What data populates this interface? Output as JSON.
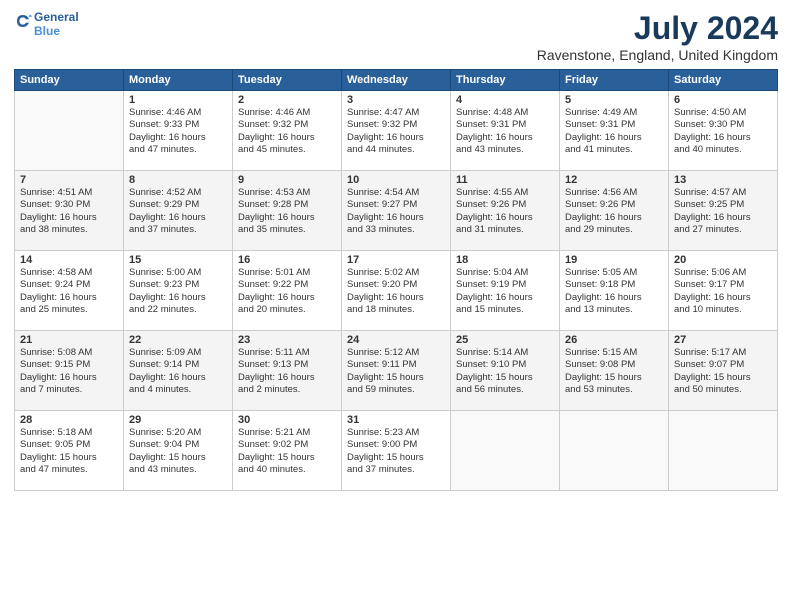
{
  "logo": {
    "line1": "General",
    "line2": "Blue"
  },
  "title": "July 2024",
  "location": "Ravenstone, England, United Kingdom",
  "weekdays": [
    "Sunday",
    "Monday",
    "Tuesday",
    "Wednesday",
    "Thursday",
    "Friday",
    "Saturday"
  ],
  "weeks": [
    [
      {
        "day": "",
        "info": ""
      },
      {
        "day": "1",
        "info": "Sunrise: 4:46 AM\nSunset: 9:33 PM\nDaylight: 16 hours\nand 47 minutes."
      },
      {
        "day": "2",
        "info": "Sunrise: 4:46 AM\nSunset: 9:32 PM\nDaylight: 16 hours\nand 45 minutes."
      },
      {
        "day": "3",
        "info": "Sunrise: 4:47 AM\nSunset: 9:32 PM\nDaylight: 16 hours\nand 44 minutes."
      },
      {
        "day": "4",
        "info": "Sunrise: 4:48 AM\nSunset: 9:31 PM\nDaylight: 16 hours\nand 43 minutes."
      },
      {
        "day": "5",
        "info": "Sunrise: 4:49 AM\nSunset: 9:31 PM\nDaylight: 16 hours\nand 41 minutes."
      },
      {
        "day": "6",
        "info": "Sunrise: 4:50 AM\nSunset: 9:30 PM\nDaylight: 16 hours\nand 40 minutes."
      }
    ],
    [
      {
        "day": "7",
        "info": "Sunrise: 4:51 AM\nSunset: 9:30 PM\nDaylight: 16 hours\nand 38 minutes."
      },
      {
        "day": "8",
        "info": "Sunrise: 4:52 AM\nSunset: 9:29 PM\nDaylight: 16 hours\nand 37 minutes."
      },
      {
        "day": "9",
        "info": "Sunrise: 4:53 AM\nSunset: 9:28 PM\nDaylight: 16 hours\nand 35 minutes."
      },
      {
        "day": "10",
        "info": "Sunrise: 4:54 AM\nSunset: 9:27 PM\nDaylight: 16 hours\nand 33 minutes."
      },
      {
        "day": "11",
        "info": "Sunrise: 4:55 AM\nSunset: 9:26 PM\nDaylight: 16 hours\nand 31 minutes."
      },
      {
        "day": "12",
        "info": "Sunrise: 4:56 AM\nSunset: 9:26 PM\nDaylight: 16 hours\nand 29 minutes."
      },
      {
        "day": "13",
        "info": "Sunrise: 4:57 AM\nSunset: 9:25 PM\nDaylight: 16 hours\nand 27 minutes."
      }
    ],
    [
      {
        "day": "14",
        "info": "Sunrise: 4:58 AM\nSunset: 9:24 PM\nDaylight: 16 hours\nand 25 minutes."
      },
      {
        "day": "15",
        "info": "Sunrise: 5:00 AM\nSunset: 9:23 PM\nDaylight: 16 hours\nand 22 minutes."
      },
      {
        "day": "16",
        "info": "Sunrise: 5:01 AM\nSunset: 9:22 PM\nDaylight: 16 hours\nand 20 minutes."
      },
      {
        "day": "17",
        "info": "Sunrise: 5:02 AM\nSunset: 9:20 PM\nDaylight: 16 hours\nand 18 minutes."
      },
      {
        "day": "18",
        "info": "Sunrise: 5:04 AM\nSunset: 9:19 PM\nDaylight: 16 hours\nand 15 minutes."
      },
      {
        "day": "19",
        "info": "Sunrise: 5:05 AM\nSunset: 9:18 PM\nDaylight: 16 hours\nand 13 minutes."
      },
      {
        "day": "20",
        "info": "Sunrise: 5:06 AM\nSunset: 9:17 PM\nDaylight: 16 hours\nand 10 minutes."
      }
    ],
    [
      {
        "day": "21",
        "info": "Sunrise: 5:08 AM\nSunset: 9:15 PM\nDaylight: 16 hours\nand 7 minutes."
      },
      {
        "day": "22",
        "info": "Sunrise: 5:09 AM\nSunset: 9:14 PM\nDaylight: 16 hours\nand 4 minutes."
      },
      {
        "day": "23",
        "info": "Sunrise: 5:11 AM\nSunset: 9:13 PM\nDaylight: 16 hours\nand 2 minutes."
      },
      {
        "day": "24",
        "info": "Sunrise: 5:12 AM\nSunset: 9:11 PM\nDaylight: 15 hours\nand 59 minutes."
      },
      {
        "day": "25",
        "info": "Sunrise: 5:14 AM\nSunset: 9:10 PM\nDaylight: 15 hours\nand 56 minutes."
      },
      {
        "day": "26",
        "info": "Sunrise: 5:15 AM\nSunset: 9:08 PM\nDaylight: 15 hours\nand 53 minutes."
      },
      {
        "day": "27",
        "info": "Sunrise: 5:17 AM\nSunset: 9:07 PM\nDaylight: 15 hours\nand 50 minutes."
      }
    ],
    [
      {
        "day": "28",
        "info": "Sunrise: 5:18 AM\nSunset: 9:05 PM\nDaylight: 15 hours\nand 47 minutes."
      },
      {
        "day": "29",
        "info": "Sunrise: 5:20 AM\nSunset: 9:04 PM\nDaylight: 15 hours\nand 43 minutes."
      },
      {
        "day": "30",
        "info": "Sunrise: 5:21 AM\nSunset: 9:02 PM\nDaylight: 15 hours\nand 40 minutes."
      },
      {
        "day": "31",
        "info": "Sunrise: 5:23 AM\nSunset: 9:00 PM\nDaylight: 15 hours\nand 37 minutes."
      },
      {
        "day": "",
        "info": ""
      },
      {
        "day": "",
        "info": ""
      },
      {
        "day": "",
        "info": ""
      }
    ]
  ]
}
